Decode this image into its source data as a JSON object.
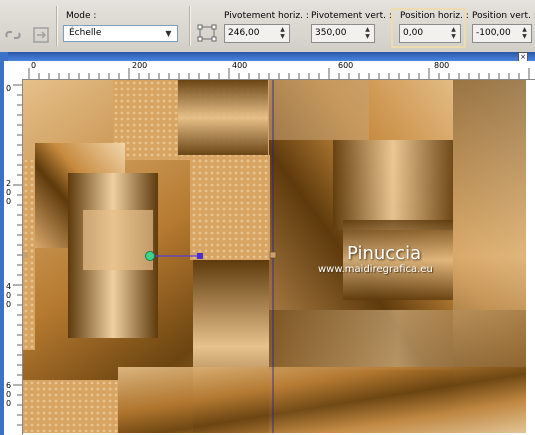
{
  "toolbar": {
    "mode_label": "Mode :",
    "mode_value": "Échelle",
    "pivot_h_label": "Pivotement horiz. :",
    "pivot_h_value": "246,00",
    "pivot_v_label": "Pivotement vert. :",
    "pivot_v_value": "350,00",
    "pos_h_label": "Position horiz. :",
    "pos_h_value": "0,00",
    "pos_v_label": "Position vert. :",
    "pos_v_value": "-100,00"
  },
  "ruler": {
    "h_labels": [
      "0",
      "200",
      "400",
      "600",
      "800"
    ],
    "v_labels": [
      "0",
      "200",
      "400",
      "600"
    ]
  },
  "watermark": {
    "title": "Pinuccia",
    "url": "www.maidiregrafica.eu"
  },
  "colors": {
    "tan": "#d9a86a",
    "brown": "#6b4410",
    "light": "#f0d2a4",
    "highlight": "#eedcb0",
    "window_blue": "#3b72c8"
  }
}
